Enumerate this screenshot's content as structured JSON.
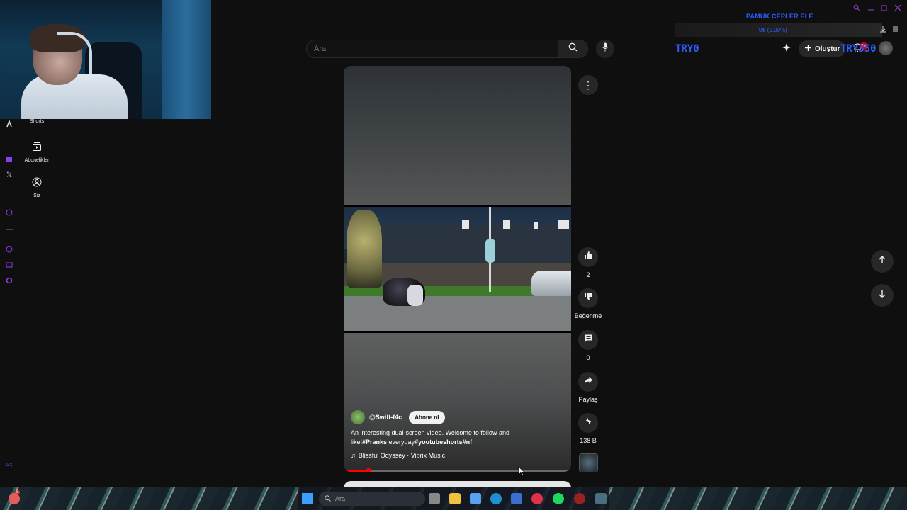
{
  "search": {
    "placeholder": "Ara"
  },
  "nav": {
    "items": [
      {
        "label": "Shorts",
        "icon": "shorts-icon"
      },
      {
        "label": "Abonelikler",
        "icon": "subscriptions-icon"
      },
      {
        "label": "Siz",
        "icon": "account-icon"
      }
    ]
  },
  "overlay": {
    "title": "PAMUK CEPLER ELE",
    "progress_text": "0₺ (0.00%)",
    "value_left": "TRY0",
    "value_right": "TRY350"
  },
  "header": {
    "create_label": "Oluştur",
    "notification_count": "9+"
  },
  "short": {
    "channel": "@Swift-f4c",
    "subscribe_label": "Abone ol",
    "desc_text": "An interesting dual-screen video. Welcome to follow and like!",
    "desc_tag1": "#Pranks",
    "desc_mid": " everyday",
    "desc_tag2": "#youtubeshorts",
    "desc_tag3": "#nf",
    "music": "Blissful Odyssey · Vibrix Music",
    "progress": 0.11
  },
  "actions": {
    "like_count": "2",
    "dislike_label": "Beğenme",
    "comment_count": "0",
    "share_label": "Paylaş",
    "remix_count": "138 B"
  },
  "taskbar": {
    "search_placeholder": "Ara",
    "tray_badge": "8"
  },
  "colors": {
    "background": "#0f0f0f",
    "overlay_blue": "#2f5bff",
    "accent_red": "#ff0000",
    "button_bg": "#272727"
  }
}
